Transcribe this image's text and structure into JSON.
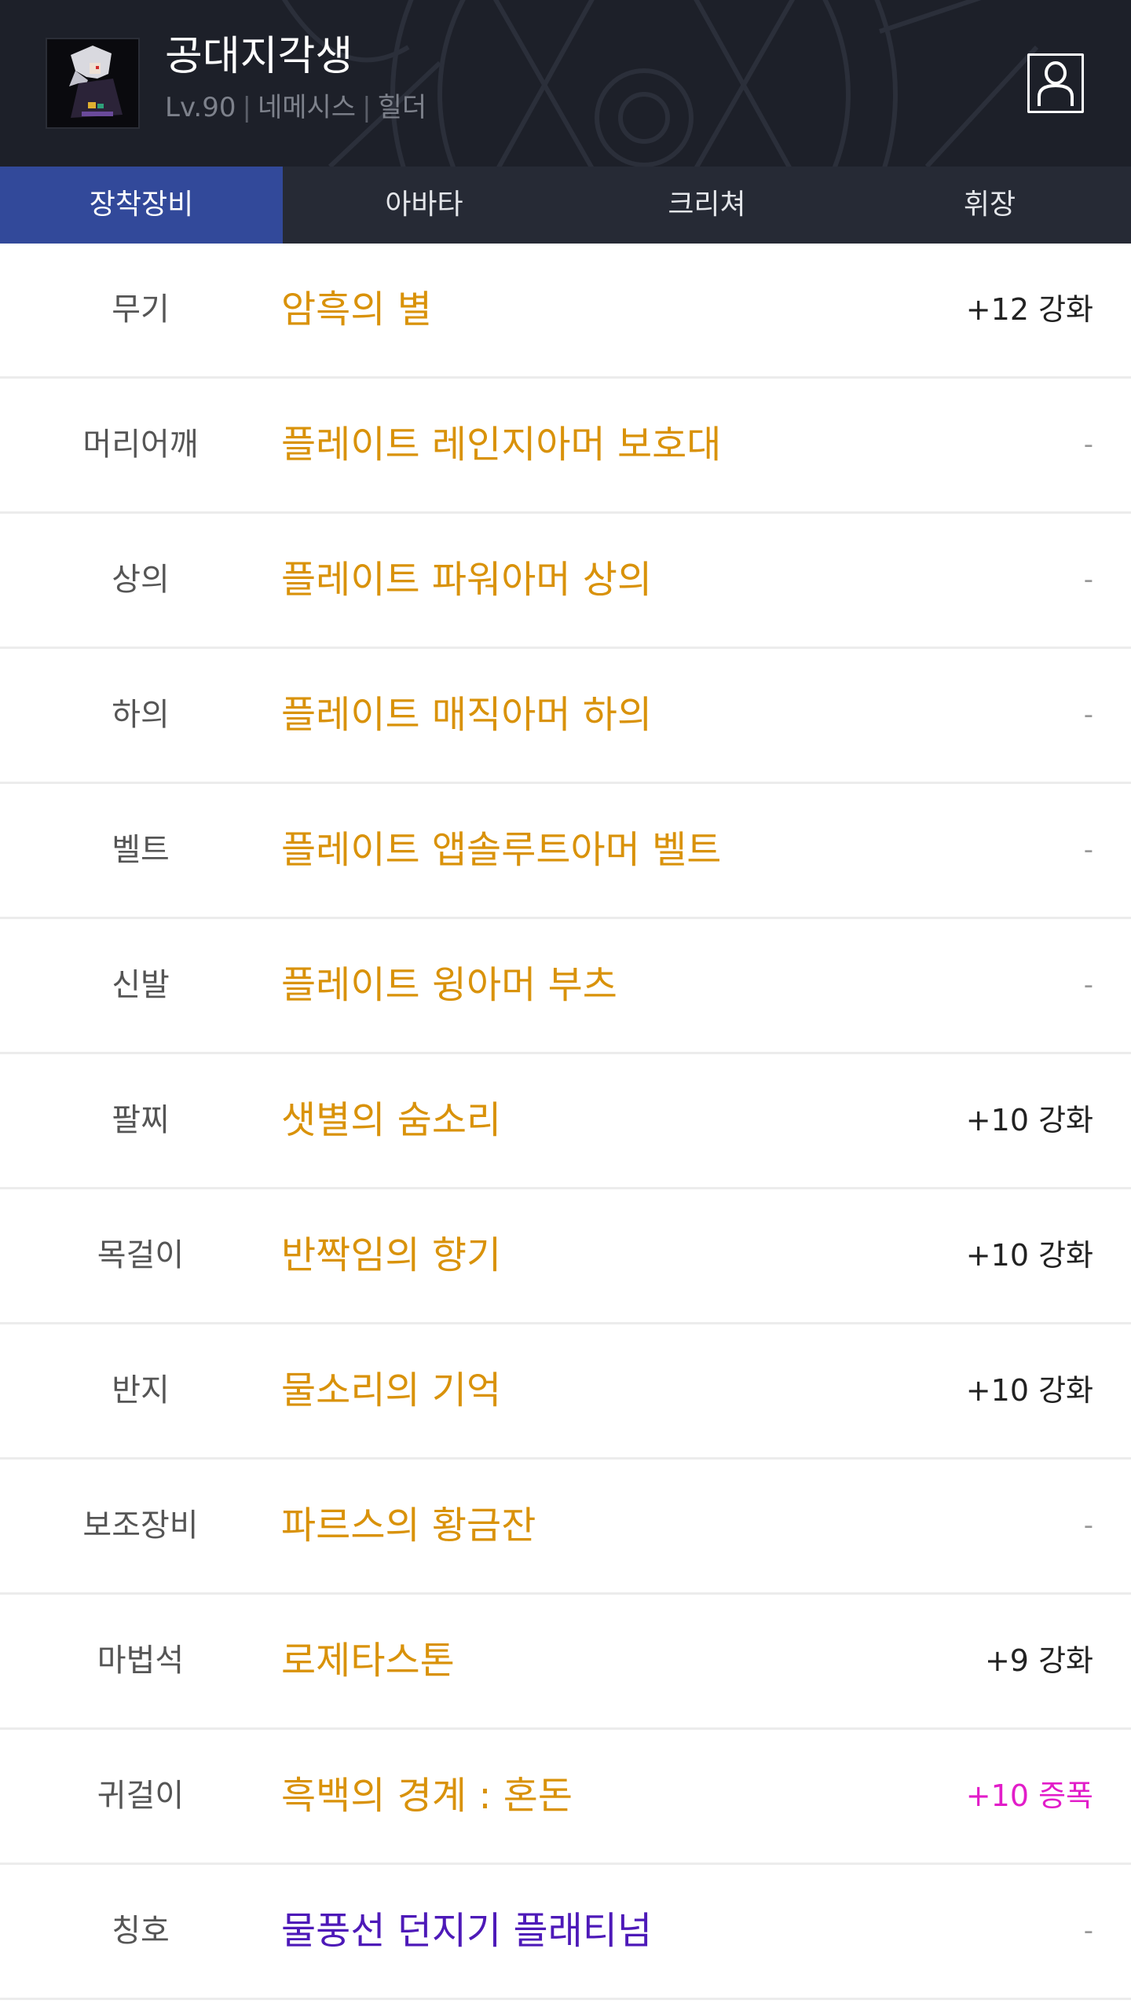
{
  "character": {
    "name": "공대지각생",
    "level": "Lv.90",
    "server": "네메시스",
    "class": "힐더",
    "separator": "|"
  },
  "icons": {
    "avatar": "character-portrait",
    "profile": "person-icon"
  },
  "colors": {
    "header_bg": "#1d2029",
    "tab_bar_bg": "#262a35",
    "tab_active_bg": "#32499a",
    "item_name": "#d9920a",
    "title_name": "#4d19b8",
    "amplify": "#e21dc9"
  },
  "tabs": [
    {
      "label": "장착장비",
      "active": true
    },
    {
      "label": "아바타",
      "active": false
    },
    {
      "label": "크리쳐",
      "active": false
    },
    {
      "label": "휘장",
      "active": false
    }
  ],
  "equipment": [
    {
      "slot": "무기",
      "item": "암흑의 별",
      "enhance": "+12 강화"
    },
    {
      "slot": "머리어깨",
      "item": "플레이트 레인지아머 보호대",
      "enhance": "-"
    },
    {
      "slot": "상의",
      "item": "플레이트 파워아머 상의",
      "enhance": "-"
    },
    {
      "slot": "하의",
      "item": "플레이트 매직아머 하의",
      "enhance": "-"
    },
    {
      "slot": "벨트",
      "item": "플레이트 앱솔루트아머 벨트",
      "enhance": "-"
    },
    {
      "slot": "신발",
      "item": "플레이트 윙아머 부츠",
      "enhance": "-"
    },
    {
      "slot": "팔찌",
      "item": "샛별의 숨소리",
      "enhance": "+10 강화"
    },
    {
      "slot": "목걸이",
      "item": "반짝임의 향기",
      "enhance": "+10 강화"
    },
    {
      "slot": "반지",
      "item": "물소리의 기억",
      "enhance": "+10 강화"
    },
    {
      "slot": "보조장비",
      "item": "파르스의 황금잔",
      "enhance": "-"
    },
    {
      "slot": "마법석",
      "item": "로제타스톤",
      "enhance": "+9 강화"
    },
    {
      "slot": "귀걸이",
      "item": "흑백의 경계 : 혼돈",
      "enhance": "+10 증폭"
    },
    {
      "slot": "칭호",
      "item": "물풍선 던지기 플래티넘",
      "enhance": "-"
    }
  ]
}
